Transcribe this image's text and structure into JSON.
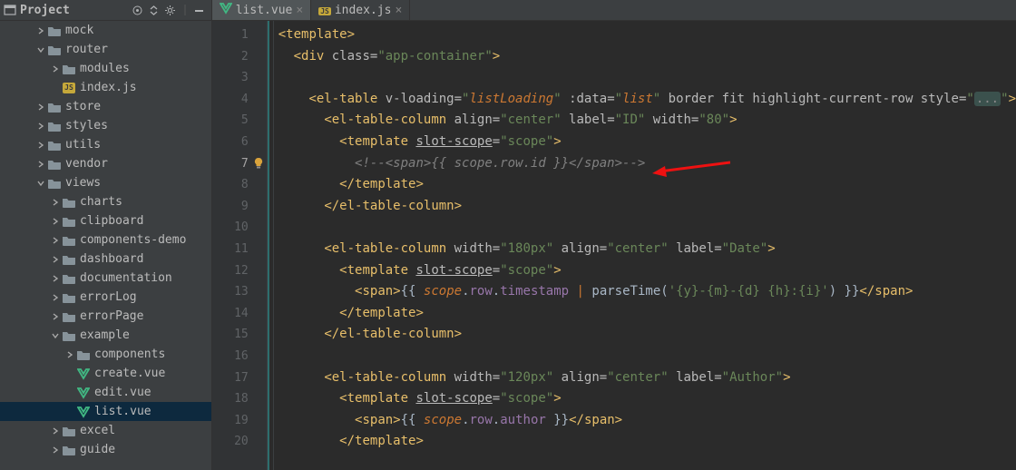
{
  "sidebar": {
    "title": "Project",
    "tools": [
      "target-icon",
      "collapse-icon",
      "gear-icon",
      "hide-icon"
    ],
    "tree": [
      {
        "d": 2,
        "t": "folder",
        "a": "r",
        "l": "mock"
      },
      {
        "d": 2,
        "t": "folder",
        "a": "d",
        "l": "router"
      },
      {
        "d": 3,
        "t": "folder",
        "a": "r",
        "l": "modules"
      },
      {
        "d": 3,
        "t": "js",
        "a": "",
        "l": "index.js"
      },
      {
        "d": 2,
        "t": "folder",
        "a": "r",
        "l": "store"
      },
      {
        "d": 2,
        "t": "folder",
        "a": "r",
        "l": "styles"
      },
      {
        "d": 2,
        "t": "folder",
        "a": "r",
        "l": "utils"
      },
      {
        "d": 2,
        "t": "folder",
        "a": "r",
        "l": "vendor"
      },
      {
        "d": 2,
        "t": "folder",
        "a": "d",
        "l": "views"
      },
      {
        "d": 3,
        "t": "folder",
        "a": "r",
        "l": "charts"
      },
      {
        "d": 3,
        "t": "folder",
        "a": "r",
        "l": "clipboard"
      },
      {
        "d": 3,
        "t": "folder",
        "a": "r",
        "l": "components-demo"
      },
      {
        "d": 3,
        "t": "folder",
        "a": "r",
        "l": "dashboard"
      },
      {
        "d": 3,
        "t": "folder",
        "a": "r",
        "l": "documentation"
      },
      {
        "d": 3,
        "t": "folder",
        "a": "r",
        "l": "errorLog"
      },
      {
        "d": 3,
        "t": "folder",
        "a": "r",
        "l": "errorPage"
      },
      {
        "d": 3,
        "t": "folder",
        "a": "d",
        "l": "example"
      },
      {
        "d": 4,
        "t": "folder",
        "a": "r",
        "l": "components"
      },
      {
        "d": 4,
        "t": "vue",
        "a": "",
        "l": "create.vue"
      },
      {
        "d": 4,
        "t": "vue",
        "a": "",
        "l": "edit.vue"
      },
      {
        "d": 4,
        "t": "vue",
        "a": "",
        "l": "list.vue",
        "sel": true
      },
      {
        "d": 3,
        "t": "folder",
        "a": "r",
        "l": "excel"
      },
      {
        "d": 3,
        "t": "folder",
        "a": "r",
        "l": "guide"
      }
    ]
  },
  "tabs": [
    {
      "icon": "vue",
      "label": "list.vue",
      "active": true
    },
    {
      "icon": "js",
      "label": "index.js",
      "active": false
    }
  ],
  "gutter": {
    "count": 20,
    "current": 7
  },
  "code": [
    [
      [
        "tag",
        "<template>"
      ]
    ],
    [
      [
        "mus",
        "  "
      ],
      [
        "tag",
        "<div "
      ],
      [
        "attr",
        "class="
      ],
      [
        "str",
        "\"app-container\""
      ],
      [
        "tag",
        ">"
      ]
    ],
    [],
    [
      [
        "mus",
        "    "
      ],
      [
        "tag",
        "<el-table "
      ],
      [
        "attr",
        "v-loading="
      ],
      [
        "str",
        "\""
      ],
      [
        "id",
        "listLoading"
      ],
      [
        "str",
        "\" "
      ],
      [
        "attr",
        ":data="
      ],
      [
        "str",
        "\""
      ],
      [
        "id",
        "list"
      ],
      [
        "str",
        "\" "
      ],
      [
        "attr",
        "border fit highlight-current-row style="
      ],
      [
        "str",
        "\""
      ],
      [
        "fold",
        "..."
      ],
      [
        "str",
        "\""
      ],
      [
        "tag",
        ">"
      ]
    ],
    [
      [
        "mus",
        "      "
      ],
      [
        "tag",
        "<el-table-column "
      ],
      [
        "attr",
        "align="
      ],
      [
        "str",
        "\"center\" "
      ],
      [
        "attr",
        "label="
      ],
      [
        "str",
        "\"ID\" "
      ],
      [
        "attr",
        "width="
      ],
      [
        "str",
        "\"80\""
      ],
      [
        "tag",
        ">"
      ]
    ],
    [
      [
        "mus",
        "        "
      ],
      [
        "tag",
        "<template "
      ],
      [
        "attr ul",
        "slot-scope"
      ],
      [
        "attr",
        "="
      ],
      [
        "str",
        "\"scope\""
      ],
      [
        "tag",
        ">"
      ]
    ],
    [
      [
        "mus",
        "          "
      ],
      [
        "com",
        "<!--<span>{{ scope.row.id }}</span>-->"
      ]
    ],
    [
      [
        "mus",
        "        "
      ],
      [
        "tag",
        "</template>"
      ]
    ],
    [
      [
        "mus",
        "      "
      ],
      [
        "tag",
        "</el-table-column>"
      ]
    ],
    [],
    [
      [
        "mus",
        "      "
      ],
      [
        "tag",
        "<el-table-column "
      ],
      [
        "attr",
        "width="
      ],
      [
        "str",
        "\"180px\" "
      ],
      [
        "attr",
        "align="
      ],
      [
        "str",
        "\"center\" "
      ],
      [
        "attr",
        "label="
      ],
      [
        "str",
        "\"Date\""
      ],
      [
        "tag",
        ">"
      ]
    ],
    [
      [
        "mus",
        "        "
      ],
      [
        "tag",
        "<template "
      ],
      [
        "attr ul",
        "slot-scope"
      ],
      [
        "attr",
        "="
      ],
      [
        "str",
        "\"scope\""
      ],
      [
        "tag",
        ">"
      ]
    ],
    [
      [
        "mus",
        "          "
      ],
      [
        "tag",
        "<span>"
      ],
      [
        "mus",
        "{{ "
      ],
      [
        "id",
        "scope"
      ],
      [
        "mus",
        "."
      ],
      [
        "pur",
        "row"
      ],
      [
        "mus",
        "."
      ],
      [
        "pur",
        "timestamp"
      ],
      [
        "mus",
        " "
      ],
      [
        "kw",
        "|"
      ],
      [
        "mus",
        " parseTime("
      ],
      [
        "str",
        "'{y}-{m}-{d} {h}:{i}'"
      ],
      [
        "mus",
        ") }}"
      ],
      [
        "tag",
        "</span>"
      ]
    ],
    [
      [
        "mus",
        "        "
      ],
      [
        "tag",
        "</template>"
      ]
    ],
    [
      [
        "mus",
        "      "
      ],
      [
        "tag",
        "</el-table-column>"
      ]
    ],
    [],
    [
      [
        "mus",
        "      "
      ],
      [
        "tag",
        "<el-table-column "
      ],
      [
        "attr",
        "width="
      ],
      [
        "str",
        "\"120px\" "
      ],
      [
        "attr",
        "align="
      ],
      [
        "str",
        "\"center\" "
      ],
      [
        "attr",
        "label="
      ],
      [
        "str",
        "\"Author\""
      ],
      [
        "tag",
        ">"
      ]
    ],
    [
      [
        "mus",
        "        "
      ],
      [
        "tag",
        "<template "
      ],
      [
        "attr ul",
        "slot-scope"
      ],
      [
        "attr",
        "="
      ],
      [
        "str",
        "\"scope\""
      ],
      [
        "tag",
        ">"
      ]
    ],
    [
      [
        "mus",
        "          "
      ],
      [
        "tag",
        "<span>"
      ],
      [
        "mus",
        "{{ "
      ],
      [
        "id",
        "scope"
      ],
      [
        "mus",
        "."
      ],
      [
        "pur",
        "row"
      ],
      [
        "mus",
        "."
      ],
      [
        "pur",
        "author"
      ],
      [
        "mus",
        " }}"
      ],
      [
        "tag",
        "</span>"
      ]
    ],
    [
      [
        "mus",
        "        "
      ],
      [
        "tag",
        "</template>"
      ]
    ]
  ]
}
